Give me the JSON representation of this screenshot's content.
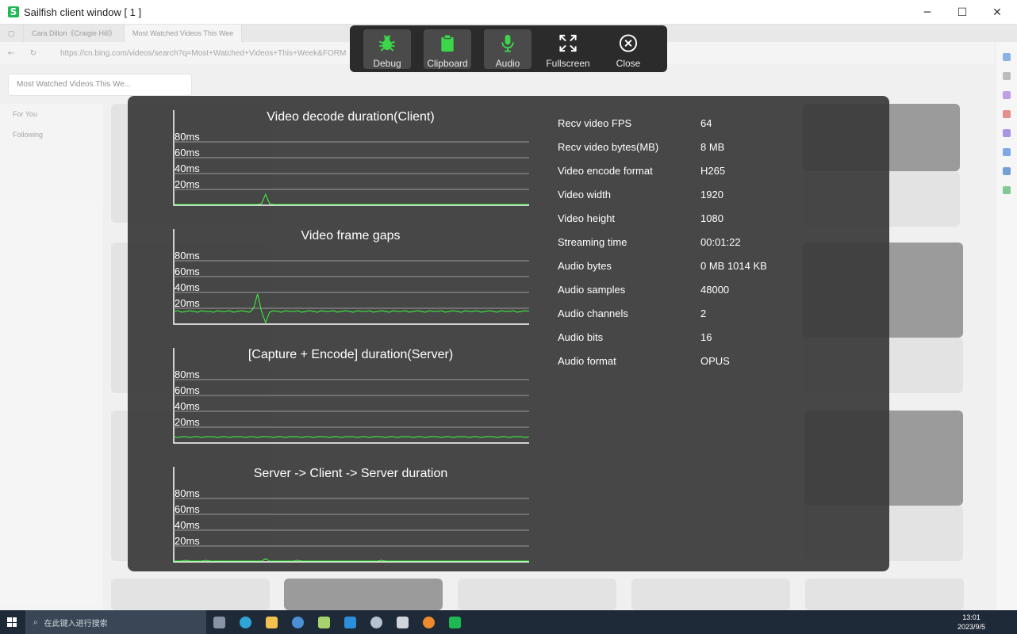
{
  "window": {
    "title": "Sailfish client window [ 1 ]",
    "minimize_icon": "─",
    "maximize_icon": "☐",
    "close_icon": "✕"
  },
  "background": {
    "tabs": [
      "Cara Dillon《Craigie Hill》",
      "Most Watched Videos This Wee"
    ],
    "url": "https://cn.bing.com/videos/search?q=Most+Watched+Videos+This+Week&FORM",
    "search_value": "Most Watched Videos This We...",
    "sidebar": [
      "For You",
      "Following"
    ]
  },
  "toolbar": [
    {
      "label": "Debug",
      "icon": "bug-icon",
      "active": true
    },
    {
      "label": "Clipboard",
      "icon": "clipboard-icon",
      "active": true
    },
    {
      "label": "Audio",
      "icon": "microphone-icon",
      "active": true
    },
    {
      "label": "Fullscreen",
      "icon": "fullscreen-icon",
      "active": false
    },
    {
      "label": "Close",
      "icon": "close-circle-icon",
      "active": false
    }
  ],
  "chart_data": [
    {
      "type": "line",
      "title": "Video decode duration(Client)",
      "yticks": [
        "80ms",
        "60ms",
        "40ms",
        "20ms"
      ],
      "ylim": [
        0,
        80
      ],
      "color": "#3cff3c",
      "x": [
        0,
        1,
        2,
        3,
        4,
        5,
        6,
        7,
        8,
        9,
        10,
        11,
        12,
        13,
        14,
        15,
        16,
        17,
        18,
        19,
        20,
        21,
        22,
        23,
        24,
        25,
        26,
        27,
        28,
        29,
        30,
        31,
        32,
        33,
        34,
        35,
        36,
        37,
        38,
        39,
        40,
        41,
        42,
        43,
        44,
        45,
        46,
        47,
        48,
        49,
        50,
        51,
        52,
        53,
        54,
        55,
        56,
        57,
        58,
        59,
        60,
        61,
        62,
        63,
        64,
        65,
        66,
        67,
        68,
        69,
        70,
        71,
        72,
        73,
        74,
        75,
        76,
        77,
        78,
        79,
        80,
        81,
        82,
        83,
        84,
        85,
        86,
        87,
        88,
        89
      ],
      "y": [
        1,
        1,
        1,
        1,
        1,
        1,
        1,
        1,
        1,
        1,
        1,
        1,
        1,
        1,
        1,
        1,
        1,
        1,
        1,
        1,
        1,
        1,
        2,
        14,
        2,
        1,
        1,
        1,
        1,
        1,
        1,
        1,
        1,
        1,
        1,
        1,
        1,
        1,
        1,
        1,
        1,
        1,
        1,
        1,
        1,
        1,
        1,
        1,
        1,
        1,
        1,
        1,
        1,
        1,
        1,
        1,
        1,
        1,
        1,
        1,
        1,
        1,
        1,
        1,
        1,
        1,
        1,
        1,
        1,
        1,
        1,
        1,
        1,
        1,
        1,
        1,
        1,
        1,
        1,
        1,
        1,
        1,
        1,
        1,
        1,
        1,
        1,
        1,
        1,
        1
      ]
    },
    {
      "type": "line",
      "title": "Video frame gaps",
      "yticks": [
        "80ms",
        "60ms",
        "40ms",
        "20ms"
      ],
      "ylim": [
        0,
        80
      ],
      "color": "#3cff3c",
      "x": [
        0,
        1,
        2,
        3,
        4,
        5,
        6,
        7,
        8,
        9,
        10,
        11,
        12,
        13,
        14,
        15,
        16,
        17,
        18,
        19,
        20,
        21,
        22,
        23,
        24,
        25,
        26,
        27,
        28,
        29,
        30,
        31,
        32,
        33,
        34,
        35,
        36,
        37,
        38,
        39,
        40,
        41,
        42,
        43,
        44,
        45,
        46,
        47,
        48,
        49,
        50,
        51,
        52,
        53,
        54,
        55,
        56,
        57,
        58,
        59,
        60,
        61,
        62,
        63,
        64,
        65,
        66,
        67,
        68,
        69,
        70,
        71,
        72,
        73,
        74,
        75,
        76,
        77,
        78,
        79,
        80,
        81,
        82,
        83,
        84,
        85,
        86,
        87,
        88,
        89
      ],
      "y": [
        16,
        17,
        15,
        16,
        17,
        16,
        15,
        17,
        16,
        16,
        15,
        17,
        16,
        16,
        17,
        15,
        16,
        17,
        16,
        15,
        20,
        38,
        16,
        2,
        15,
        17,
        16,
        15,
        17,
        16,
        16,
        17,
        15,
        16,
        17,
        16,
        15,
        17,
        16,
        16,
        17,
        15,
        16,
        17,
        16,
        15,
        17,
        16,
        16,
        17,
        15,
        16,
        17,
        16,
        15,
        17,
        16,
        16,
        17,
        15,
        16,
        17,
        16,
        15,
        17,
        16,
        16,
        17,
        15,
        16,
        17,
        16,
        15,
        17,
        16,
        16,
        17,
        15,
        16,
        17,
        16,
        15,
        17,
        16,
        16,
        17,
        15,
        16,
        17,
        16
      ]
    },
    {
      "type": "line",
      "title": "[Capture + Encode] duration(Server)",
      "yticks": [
        "80ms",
        "60ms",
        "40ms",
        "20ms"
      ],
      "ylim": [
        0,
        80
      ],
      "color": "#3cff3c",
      "x": [
        0,
        1,
        2,
        3,
        4,
        5,
        6,
        7,
        8,
        9,
        10,
        11,
        12,
        13,
        14,
        15,
        16,
        17,
        18,
        19,
        20,
        21,
        22,
        23,
        24,
        25,
        26,
        27,
        28,
        29,
        30,
        31,
        32,
        33,
        34,
        35,
        36,
        37,
        38,
        39,
        40,
        41,
        42,
        43,
        44,
        45,
        46,
        47,
        48,
        49,
        50,
        51,
        52,
        53,
        54,
        55,
        56,
        57,
        58,
        59,
        60,
        61,
        62,
        63,
        64,
        65,
        66,
        67,
        68,
        69,
        70,
        71,
        72,
        73,
        74,
        75,
        76,
        77,
        78,
        79,
        80,
        81,
        82,
        83,
        84,
        85,
        86,
        87,
        88,
        89
      ],
      "y": [
        8,
        7,
        8,
        8,
        7,
        8,
        8,
        7,
        8,
        8,
        8,
        7,
        8,
        8,
        7,
        8,
        8,
        8,
        7,
        8,
        8,
        7,
        8,
        8,
        8,
        7,
        8,
        8,
        7,
        8,
        8,
        8,
        7,
        8,
        8,
        7,
        8,
        8,
        8,
        7,
        8,
        8,
        7,
        8,
        8,
        8,
        7,
        8,
        8,
        7,
        8,
        8,
        8,
        7,
        8,
        8,
        7,
        8,
        8,
        8,
        7,
        8,
        8,
        7,
        8,
        8,
        8,
        7,
        8,
        8,
        7,
        8,
        8,
        8,
        7,
        8,
        8,
        7,
        8,
        8,
        8,
        7,
        8,
        8,
        7,
        8,
        8,
        8,
        7,
        8
      ]
    },
    {
      "type": "line",
      "title": "Server -> Client -> Server duration",
      "yticks": [
        "80ms",
        "60ms",
        "40ms",
        "20ms"
      ],
      "ylim": [
        0,
        80
      ],
      "color": "#3cff3c",
      "x": [
        0,
        1,
        2,
        3,
        4,
        5,
        6,
        7,
        8,
        9,
        10,
        11,
        12,
        13,
        14,
        15,
        16,
        17,
        18,
        19,
        20,
        21,
        22,
        23,
        24,
        25,
        26,
        27,
        28,
        29,
        30,
        31,
        32,
        33,
        34,
        35,
        36,
        37,
        38,
        39,
        40,
        41,
        42,
        43,
        44,
        45,
        46,
        47,
        48,
        49,
        50,
        51,
        52,
        53,
        54,
        55,
        56,
        57,
        58,
        59,
        60,
        61,
        62,
        63,
        64,
        65,
        66,
        67,
        68,
        69,
        70,
        71,
        72,
        73,
        74,
        75,
        76,
        77,
        78,
        79,
        80,
        81,
        82,
        83,
        84,
        85,
        86,
        87,
        88,
        89
      ],
      "y": [
        1,
        1,
        1,
        2,
        1,
        1,
        1,
        1,
        2,
        1,
        1,
        1,
        1,
        1,
        1,
        1,
        1,
        1,
        1,
        1,
        1,
        1,
        1,
        4,
        1,
        1,
        1,
        1,
        1,
        1,
        1,
        2,
        1,
        1,
        1,
        1,
        1,
        1,
        1,
        1,
        1,
        1,
        1,
        1,
        1,
        1,
        1,
        1,
        1,
        1,
        1,
        1,
        2,
        1,
        1,
        1,
        1,
        1,
        1,
        1,
        1,
        1,
        1,
        1,
        1,
        1,
        1,
        1,
        1,
        1,
        1,
        1,
        1,
        1,
        1,
        1,
        1,
        1,
        1,
        1,
        1,
        1,
        1,
        1,
        1,
        1,
        1,
        1,
        1,
        1
      ]
    }
  ],
  "stats": [
    {
      "label": "Recv video FPS",
      "value": "64"
    },
    {
      "label": "Recv video bytes(MB)",
      "value": "8 MB"
    },
    {
      "label": "Video encode format",
      "value": "H265"
    },
    {
      "label": "Video width",
      "value": "1920"
    },
    {
      "label": "Video height",
      "value": "1080"
    },
    {
      "label": "Streaming time",
      "value": "00:01:22"
    },
    {
      "label": "Audio bytes",
      "value": "0 MB 1014 KB"
    },
    {
      "label": "Audio samples",
      "value": "48000"
    },
    {
      "label": "Audio channels",
      "value": "2"
    },
    {
      "label": "Audio bits",
      "value": "16"
    },
    {
      "label": "Audio format",
      "value": "OPUS"
    }
  ],
  "taskbar": {
    "search_placeholder": "在此键入进行搜索",
    "time": "13:01",
    "date": "2023/9/5"
  }
}
